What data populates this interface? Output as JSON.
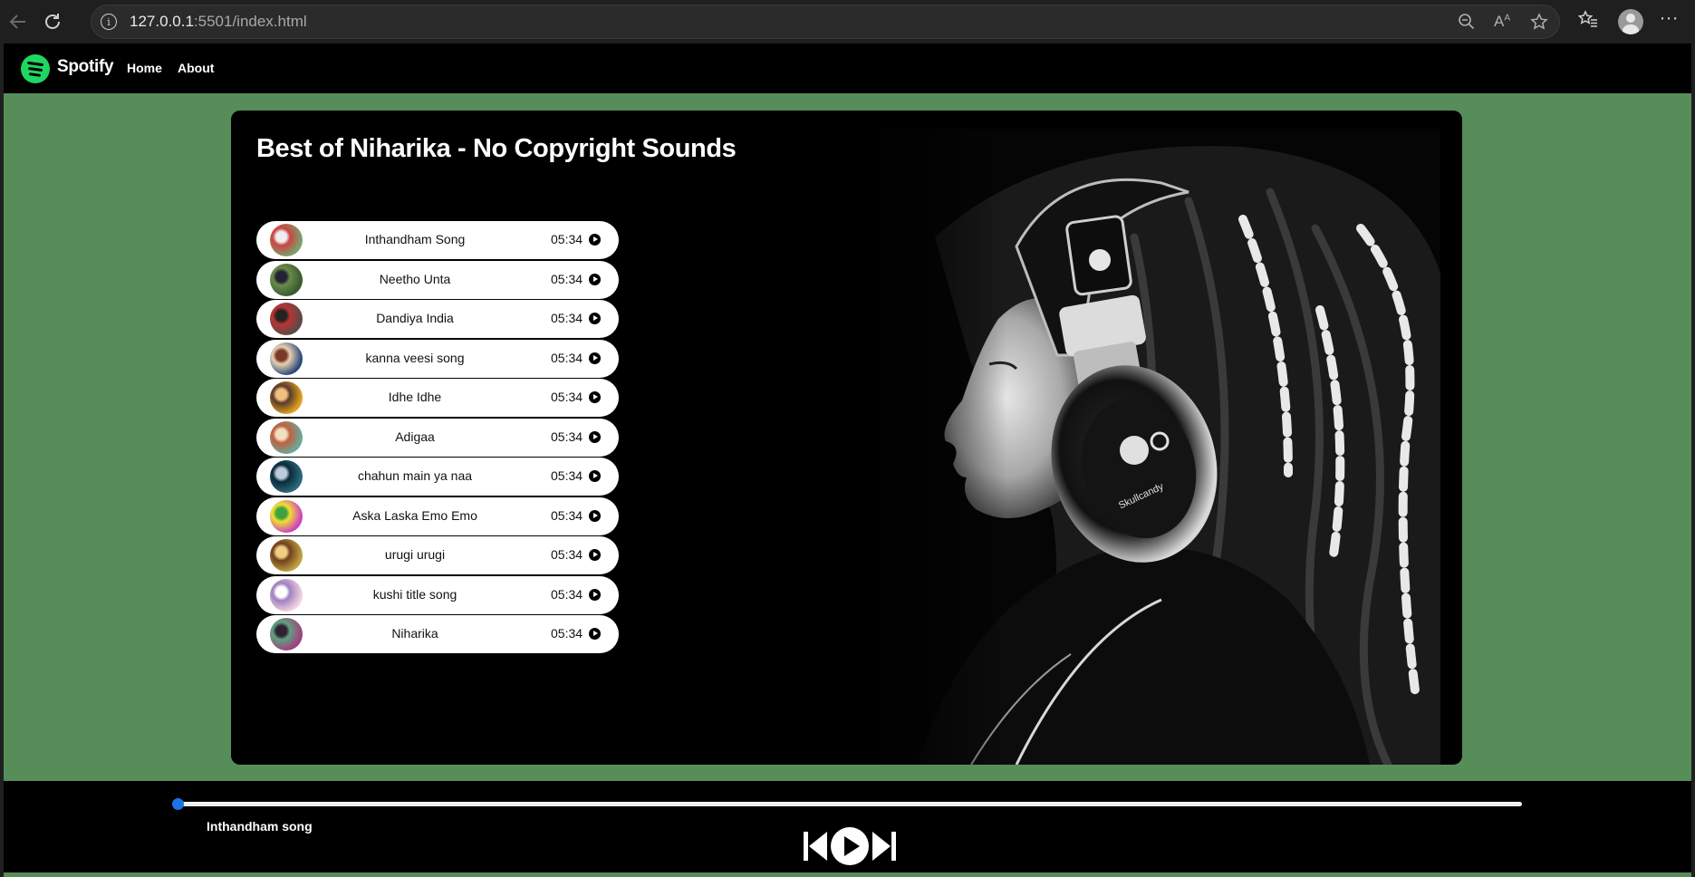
{
  "browser": {
    "url_host": "127.0.0.1",
    "url_rest": ":5501/index.html"
  },
  "navbar": {
    "brand": "Spotify",
    "links": [
      "Home",
      "About"
    ]
  },
  "playlist": {
    "title": "Best of Niharika - No Copyright Sounds",
    "songs": [
      {
        "name": "Inthandham Song",
        "duration": "05:34"
      },
      {
        "name": "Neetho Unta",
        "duration": "05:34"
      },
      {
        "name": "Dandiya India",
        "duration": "05:34"
      },
      {
        "name": "kanna veesi song",
        "duration": "05:34"
      },
      {
        "name": "Idhe Idhe",
        "duration": "05:34"
      },
      {
        "name": "Adigaa",
        "duration": "05:34"
      },
      {
        "name": "chahun main ya naa",
        "duration": "05:34"
      },
      {
        "name": "Aska Laska Emo Emo",
        "duration": "05:34"
      },
      {
        "name": "urugi urugi",
        "duration": "05:34"
      },
      {
        "name": "kushi title song",
        "duration": "05:34"
      },
      {
        "name": "Niharika",
        "duration": "05:34"
      }
    ]
  },
  "player": {
    "now_playing": "Inthandham song",
    "progress": 0,
    "accent": "#1a73e8"
  },
  "colors": {
    "page_bg": "#578d58",
    "brand_green": "#1ed760"
  },
  "icons": [
    "back-icon",
    "reload-icon",
    "info-icon",
    "zoom-icon",
    "read-aloud-icon",
    "favorite-star-icon",
    "favorites-icon",
    "profile-icon",
    "more-icon",
    "spotify-logo-icon",
    "play-circle-icon",
    "previous-icon",
    "play-icon",
    "next-icon"
  ]
}
